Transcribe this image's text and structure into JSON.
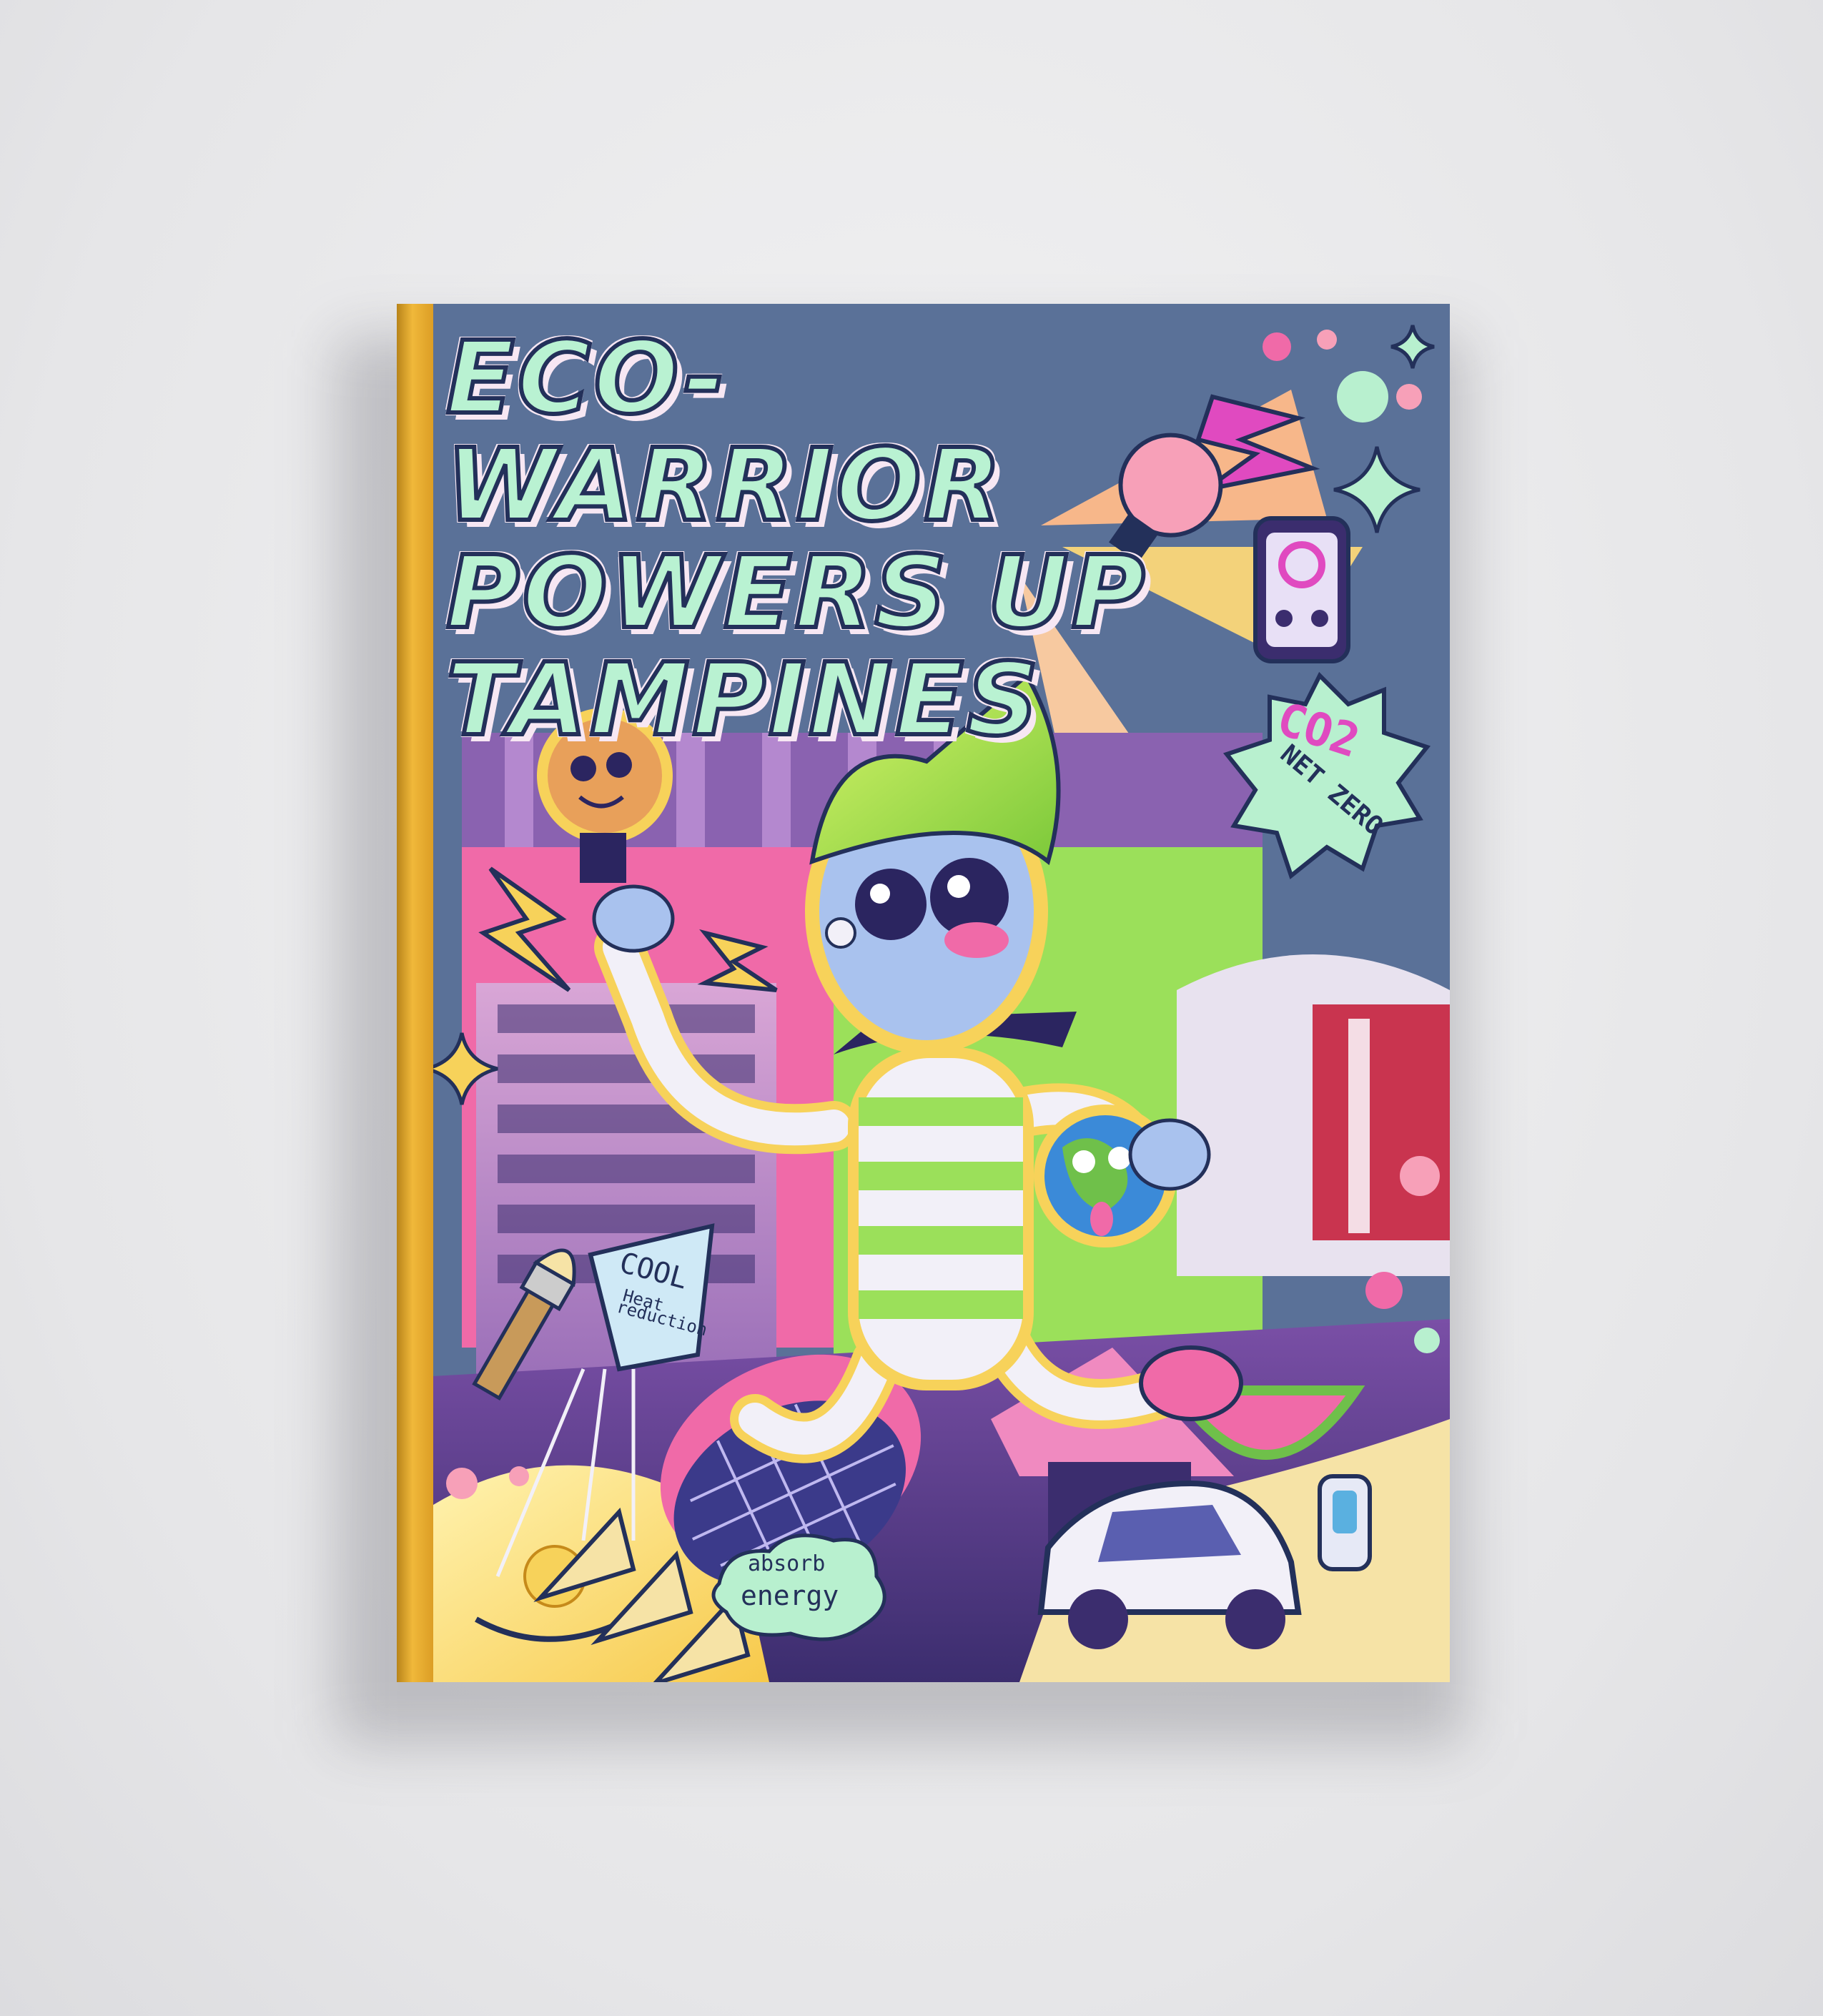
{
  "book": {
    "title_lines": [
      "ECO-WARRIOR",
      "POWERS UP",
      "TAMPINES"
    ],
    "badge_co2": "CO2",
    "badge_net_zero": "NET ZERO",
    "cup_label_cool": "COOL",
    "cup_label_heat": "Heat",
    "cup_label_reduction": "reduction",
    "cloud_absorb": "absorb",
    "cloud_energy": "energy"
  },
  "colors": {
    "cover_bg": "#5a7198",
    "spine": "#f0b83a",
    "accent_green": "#9be05a",
    "accent_pink": "#f06aa8",
    "accent_yellow": "#f7d25a"
  }
}
